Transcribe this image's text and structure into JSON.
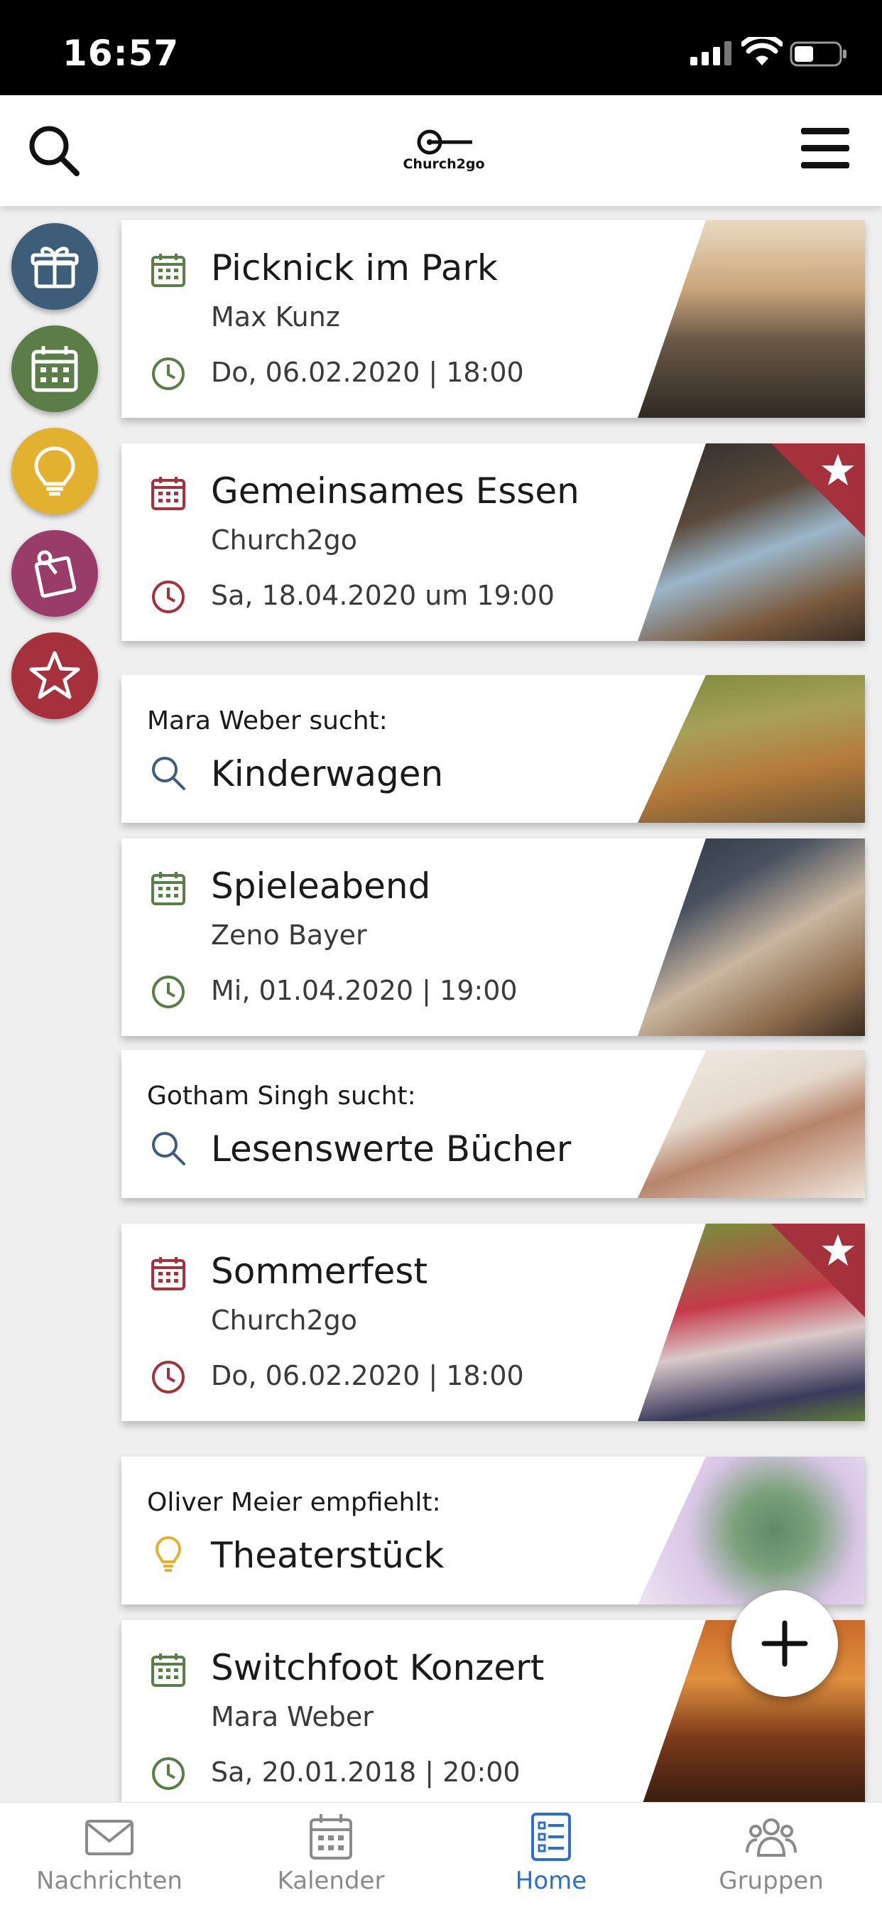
{
  "status": {
    "time": "16:57"
  },
  "app": {
    "wordmark": "Church2go"
  },
  "colors": {
    "blue": "#3d5d78",
    "green": "#5b7d48",
    "yellow": "#e2b12f",
    "magenta": "#9a3c6a",
    "red": "#a5313c",
    "active": "#2a6ed0"
  },
  "sidebar": [
    {
      "icon": "gift-icon",
      "color": "#3d5d78"
    },
    {
      "icon": "calendar-icon",
      "color": "#5b7d48"
    },
    {
      "icon": "lightbulb-icon",
      "color": "#e2b12f"
    },
    {
      "icon": "pinned-note-icon",
      "color": "#9a3c6a"
    },
    {
      "icon": "star-icon",
      "color": "#a5313c"
    }
  ],
  "cards": {
    "picknick": {
      "title": "Picknick im Park",
      "sub": "Max Kunz",
      "date": "Do, 06.02.2020 | 18:00"
    },
    "essen": {
      "title": "Gemeinsames Essen",
      "sub": "Church2go",
      "date": "Sa, 18.04.2020 um 19:00"
    },
    "kinderwagen": {
      "person": "Mara Weber",
      "verb": "sucht:",
      "title": "Kinderwagen"
    },
    "spieleabend": {
      "title": "Spieleabend",
      "sub": "Zeno Bayer",
      "date": "Mi, 01.04.2020 | 19:00"
    },
    "buecher": {
      "person": "Gotham Singh",
      "verb": "sucht:",
      "title": "Lesenswerte Bücher"
    },
    "sommerfest": {
      "title": "Sommerfest",
      "sub": "Church2go",
      "date": "Do, 06.02.2020 | 18:00"
    },
    "theater": {
      "person": "Oliver Meier",
      "verb": "empfiehlt:",
      "title": "Theaterstück"
    },
    "konzert": {
      "title": "Switchfoot Konzert",
      "sub": "Mara Weber",
      "date": "Sa, 20.01.2018 | 20:00"
    }
  },
  "tabs": {
    "nachrichten": "Nachrichten",
    "kalender": "Kalender",
    "home": "Home",
    "gruppen": "Gruppen"
  }
}
